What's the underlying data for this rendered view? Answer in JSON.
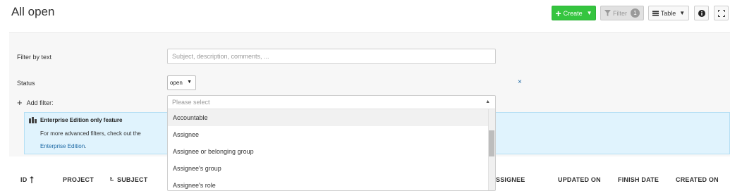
{
  "page": {
    "title": "All open"
  },
  "toolbar": {
    "create_label": "Create",
    "filter_label": "Filter",
    "filter_count": "1",
    "table_label": "Table",
    "info_icon": "info-icon",
    "fullscreen_icon": "fullscreen-icon"
  },
  "filters": {
    "text_label": "Filter by text",
    "text_placeholder": "Subject, description, comments, ...",
    "status_label": "Status",
    "status_value": "open",
    "remove_symbol": "×",
    "add_label": "Add filter:",
    "select_placeholder": "Please select"
  },
  "enterprise": {
    "title": "Enterprise Edition only feature",
    "line1": "For more advanced filters, check out the",
    "link": "Enterprise Edition",
    "suffix": "."
  },
  "dropdown": {
    "options": [
      {
        "label": "Accountable",
        "highlighted": true
      },
      {
        "label": "Assignee",
        "highlighted": false
      },
      {
        "label": "Assignee or belonging group",
        "highlighted": false
      },
      {
        "label": "Assignee's group",
        "highlighted": false
      },
      {
        "label": "Assignee's role",
        "highlighted": false
      }
    ]
  },
  "table": {
    "columns": {
      "id": "ID",
      "project": "PROJECT",
      "subject": "SUBJECT",
      "assignee": "SSIGNEE",
      "updated": "UPDATED ON",
      "finish": "FINISH DATE",
      "created": "CREATED ON"
    }
  },
  "colors": {
    "create_button": "#35c53f",
    "link": "#1a67a3",
    "banner_bg": "#e0f3fd",
    "panel_bg": "#f7f7f7"
  }
}
